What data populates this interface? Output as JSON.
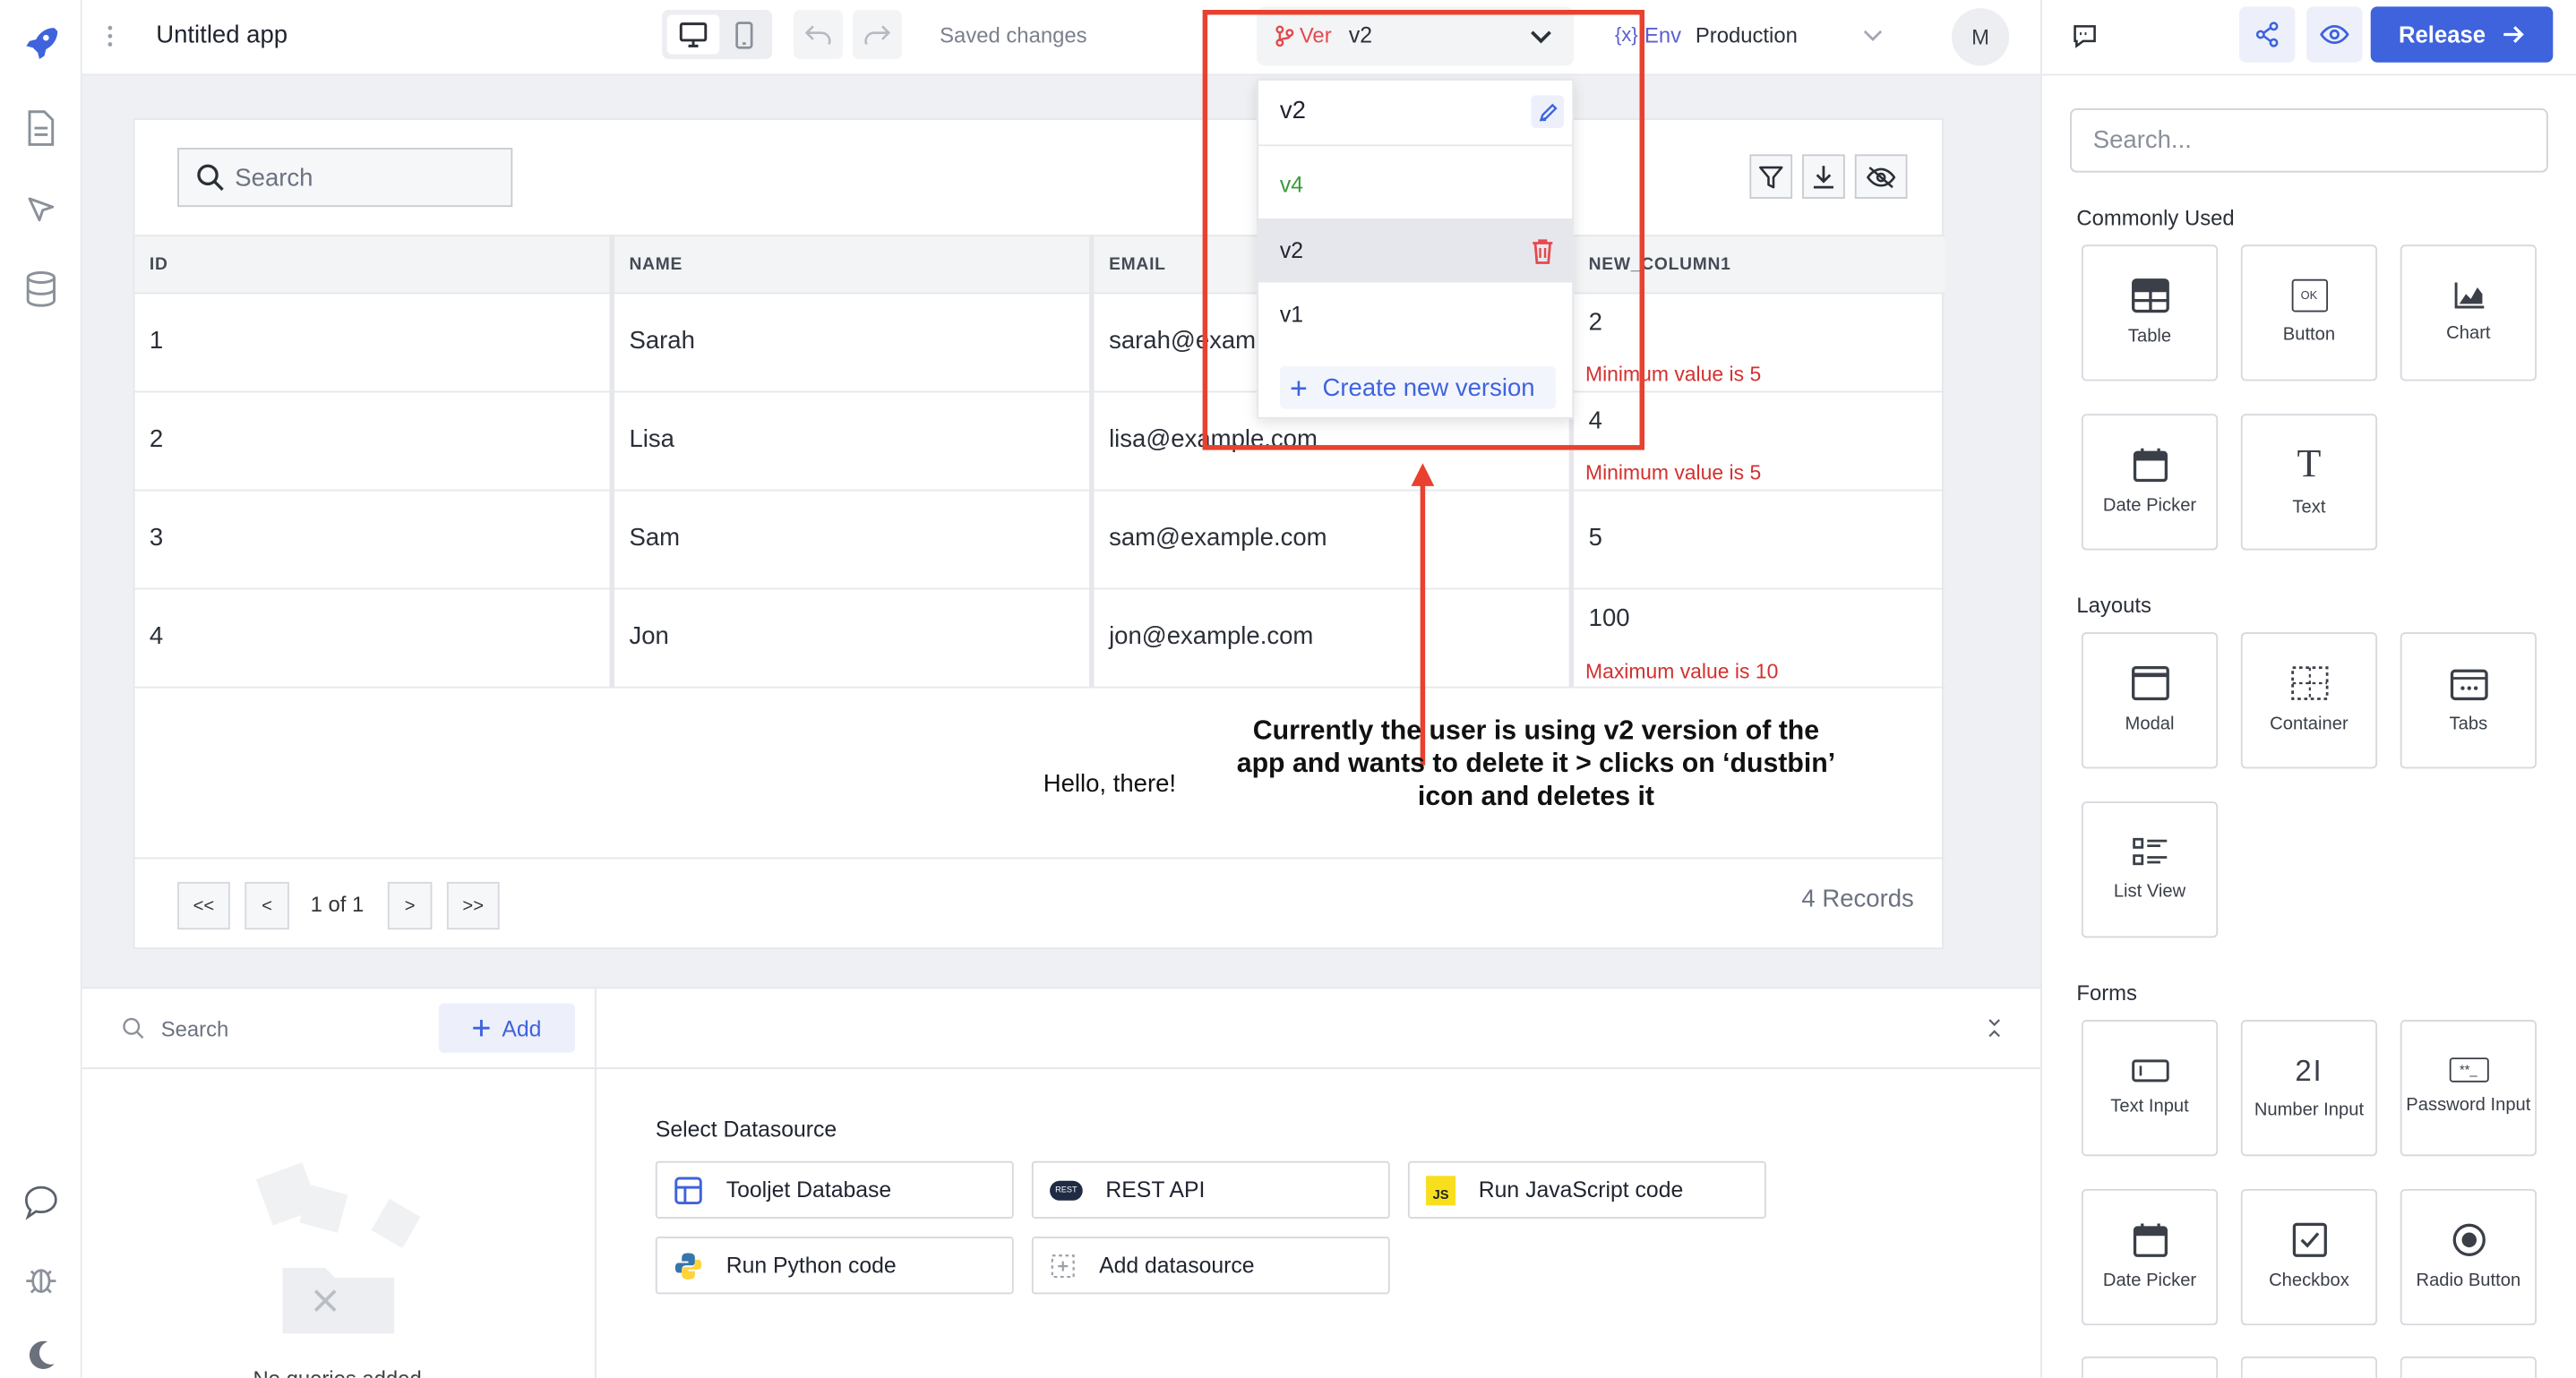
{
  "app": {
    "title": "Untitled app",
    "saved_status": "Saved changes"
  },
  "version": {
    "label": "Ver",
    "current": "v2",
    "options": [
      "v4",
      "v2",
      "v1"
    ],
    "menu_current": "v2",
    "create_label": "Create new version"
  },
  "env": {
    "label": "Env",
    "icon_text": "{x}",
    "current": "Production"
  },
  "avatar": "M",
  "release_label": "Release",
  "table": {
    "search_placeholder": "Search",
    "columns": [
      "ID",
      "NAME",
      "EMAIL",
      "NEW_COLUMN1"
    ],
    "rows": [
      {
        "id": "1",
        "name": "Sarah",
        "email": "sarah@example.com",
        "value": "2",
        "error": "Minimum value is 5"
      },
      {
        "id": "2",
        "name": "Lisa",
        "email": "lisa@example.com",
        "value": "4",
        "error": "Minimum value is 5"
      },
      {
        "id": "3",
        "name": "Sam",
        "email": "sam@example.com",
        "value": "5",
        "error": ""
      },
      {
        "id": "4",
        "name": "Jon",
        "email": "jon@example.com",
        "value": "100",
        "error": "Maximum value is 10"
      }
    ],
    "pagination": {
      "first": "<<",
      "prev": "<",
      "page_info": "1 of 1",
      "next": ">",
      "last": ">>"
    },
    "records": "4 Records"
  },
  "canvas_text": "Hello, there!",
  "annotation": "Currently the user is using v2 version of the app and wants to delete it > clicks on ‘dustbin’ icon and deletes it",
  "queries": {
    "search_placeholder": "Search",
    "add_label": "Add",
    "empty_text": "No queries added"
  },
  "datasource": {
    "heading": "Select Datasource",
    "items": [
      "Tooljet Database",
      "REST API",
      "Run JavaScript code",
      "Run Python code",
      "Add datasource"
    ],
    "js_badge": "JS",
    "rest_badge": "REST"
  },
  "widgets": {
    "search_placeholder": "Search...",
    "commonly_used": {
      "title": "Commonly Used",
      "items": [
        "Table",
        "Button",
        "Chart",
        "Date Picker",
        "Text"
      ],
      "button_glyph": "OK",
      "text_glyph": "T"
    },
    "layouts": {
      "title": "Layouts",
      "items": [
        "Modal",
        "Container",
        "Tabs",
        "List View"
      ]
    },
    "forms": {
      "title": "Forms",
      "items": [
        "Text Input",
        "Number Input",
        "Password Input",
        "Date Picker",
        "Checkbox",
        "Radio Button"
      ],
      "number_glyph": "2I",
      "password_glyph": "**_"
    }
  },
  "colors": {
    "brand": "#3e63dd",
    "error": "#d3302f",
    "annotation": "#e8412f",
    "v4_green": "#3c9a3c"
  }
}
